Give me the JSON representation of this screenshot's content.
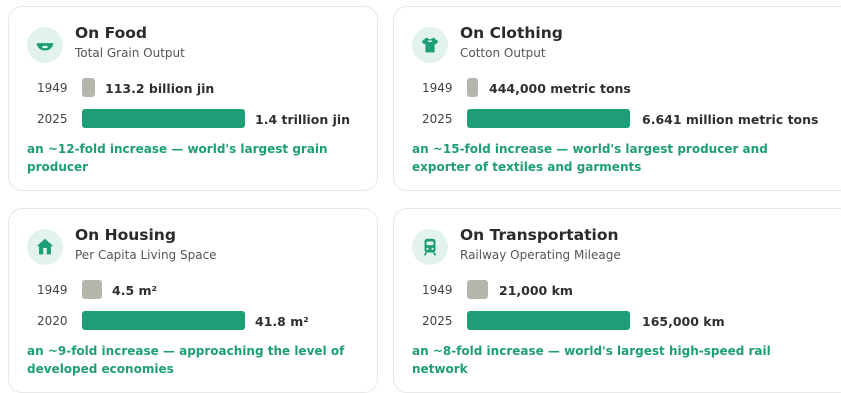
{
  "colors": {
    "accent": "#1e9e76",
    "baseline_bar": "#b6b6ad",
    "icon_bg": "#e2f3ec"
  },
  "cards": [
    {
      "icon": "bowl-icon",
      "title": "On Food",
      "subtitle": "Total Grain Output",
      "rows": [
        {
          "year": "1949",
          "value": "113.2 billion jin"
        },
        {
          "year": "2025",
          "value": "1.4 trillion jin"
        }
      ],
      "note": "an ~12-fold increase — world's largest grain producer"
    },
    {
      "icon": "shirt-icon",
      "title": "On Clothing",
      "subtitle": "Cotton Output",
      "rows": [
        {
          "year": "1949",
          "value": "444,000 metric tons"
        },
        {
          "year": "2025",
          "value": "6.641 million metric tons"
        }
      ],
      "note": "an ~15-fold increase — world's largest producer and exporter of textiles and garments"
    },
    {
      "icon": "house-icon",
      "title": "On Housing",
      "subtitle": "Per Capita Living Space",
      "rows": [
        {
          "year": "1949",
          "value": "4.5 m²"
        },
        {
          "year": "2020",
          "value": "41.8 m²"
        }
      ],
      "note": "an ~9-fold increase — approaching the level of developed economies"
    },
    {
      "icon": "train-icon",
      "title": "On Transportation",
      "subtitle": "Railway Operating Mileage",
      "rows": [
        {
          "year": "1949",
          "value": "21,000 km"
        },
        {
          "year": "2025",
          "value": "165,000 km"
        }
      ],
      "note": "an ~8-fold increase — world's largest high-speed rail network"
    }
  ]
}
